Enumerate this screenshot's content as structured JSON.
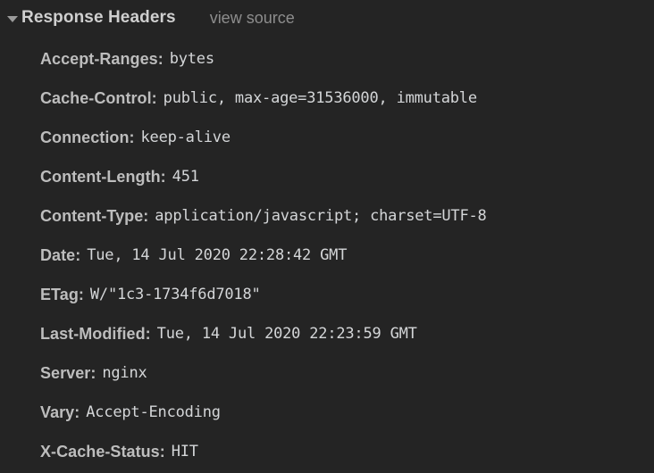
{
  "section": {
    "title": "Response Headers",
    "view_source_label": "view source",
    "expanded": true,
    "disclosure_icon": "triangle-down-icon"
  },
  "colors": {
    "background": "#242424",
    "title_text": "#cfcfcf",
    "header_name_text": "#bdbdbd",
    "header_value_text": "#d4d6d8",
    "view_source_text": "#8d8d8d",
    "triangle": "#9b9b9b"
  },
  "headers": [
    {
      "name": "Accept-Ranges",
      "value": "bytes"
    },
    {
      "name": "Cache-Control",
      "value": "public, max-age=31536000, immutable"
    },
    {
      "name": "Connection",
      "value": "keep-alive"
    },
    {
      "name": "Content-Length",
      "value": "451"
    },
    {
      "name": "Content-Type",
      "value": "application/javascript; charset=UTF-8"
    },
    {
      "name": "Date",
      "value": "Tue, 14 Jul 2020 22:28:42 GMT"
    },
    {
      "name": "ETag",
      "value": "W/\"1c3-1734f6d7018\""
    },
    {
      "name": "Last-Modified",
      "value": "Tue, 14 Jul 2020 22:23:59 GMT"
    },
    {
      "name": "Server",
      "value": "nginx"
    },
    {
      "name": "Vary",
      "value": "Accept-Encoding"
    },
    {
      "name": "X-Cache-Status",
      "value": "HIT"
    }
  ],
  "punctuation": {
    "colon": ":"
  }
}
